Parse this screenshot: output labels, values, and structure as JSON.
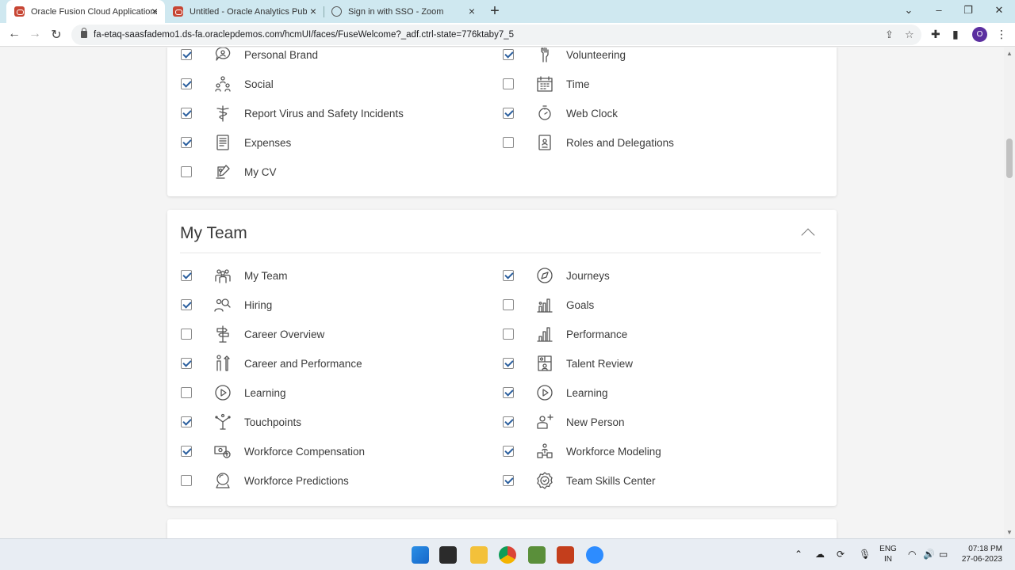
{
  "browser": {
    "tabs": [
      {
        "title": "Oracle Fusion Cloud Applications",
        "active": true,
        "favicon": "oracle-icon"
      },
      {
        "title": "Untitled - Oracle Analytics Publis",
        "active": false,
        "favicon": "oracle-icon"
      },
      {
        "title": "Sign in with SSO - Zoom",
        "active": false,
        "favicon": "globe-icon"
      }
    ],
    "new_tab": "+",
    "url": "fa-etaq-saasfademo1.ds-fa.oraclepdemos.com/hcmUI/faces/FuseWelcome?_adf.ctrl-state=776ktaby7_5",
    "profile_initial": "O"
  },
  "me_section": {
    "items_left": [
      {
        "label": "Personal Brand",
        "checked": true,
        "icon": "personal-brand-icon"
      },
      {
        "label": "Social",
        "checked": true,
        "icon": "social-icon"
      },
      {
        "label": "Report Virus and Safety Incidents",
        "checked": true,
        "icon": "caduceus-icon"
      },
      {
        "label": "Expenses",
        "checked": true,
        "icon": "expenses-icon"
      },
      {
        "label": "My CV",
        "checked": false,
        "icon": "my-cv-icon"
      }
    ],
    "items_right": [
      {
        "label": "Volunteering",
        "checked": true,
        "icon": "volunteering-icon"
      },
      {
        "label": "Time",
        "checked": false,
        "icon": "calendar-icon"
      },
      {
        "label": "Web Clock",
        "checked": true,
        "icon": "stopwatch-icon"
      },
      {
        "label": "Roles and Delegations",
        "checked": false,
        "icon": "badge-icon"
      }
    ]
  },
  "my_team_section": {
    "title": "My Team",
    "items_left": [
      {
        "label": "My Team",
        "checked": true,
        "icon": "team-icon"
      },
      {
        "label": "Hiring",
        "checked": true,
        "icon": "hiring-icon"
      },
      {
        "label": "Career Overview",
        "checked": false,
        "icon": "signpost-icon"
      },
      {
        "label": "Career and Performance",
        "checked": true,
        "icon": "career-performance-icon"
      },
      {
        "label": "Learning",
        "checked": false,
        "icon": "play-circle-icon"
      },
      {
        "label": "Touchpoints",
        "checked": true,
        "icon": "touchpoints-icon"
      },
      {
        "label": "Workforce Compensation",
        "checked": true,
        "icon": "compensation-icon"
      },
      {
        "label": "Workforce Predictions",
        "checked": false,
        "icon": "crystal-ball-icon"
      }
    ],
    "items_right": [
      {
        "label": "Journeys",
        "checked": true,
        "icon": "compass-icon"
      },
      {
        "label": "Goals",
        "checked": false,
        "icon": "goals-chart-icon"
      },
      {
        "label": "Performance",
        "checked": false,
        "icon": "performance-chart-icon"
      },
      {
        "label": "Talent Review",
        "checked": true,
        "icon": "talent-review-icon"
      },
      {
        "label": "Learning",
        "checked": true,
        "icon": "play-circle-icon"
      },
      {
        "label": "New Person",
        "checked": true,
        "icon": "new-person-icon"
      },
      {
        "label": "Workforce Modeling",
        "checked": true,
        "icon": "workforce-modeling-icon"
      },
      {
        "label": "Team Skills Center",
        "checked": true,
        "icon": "skills-badge-icon"
      }
    ]
  },
  "taskbar": {
    "lang_top": "ENG",
    "lang_bottom": "IN",
    "time": "07:18 PM",
    "date": "27-06-2023"
  }
}
